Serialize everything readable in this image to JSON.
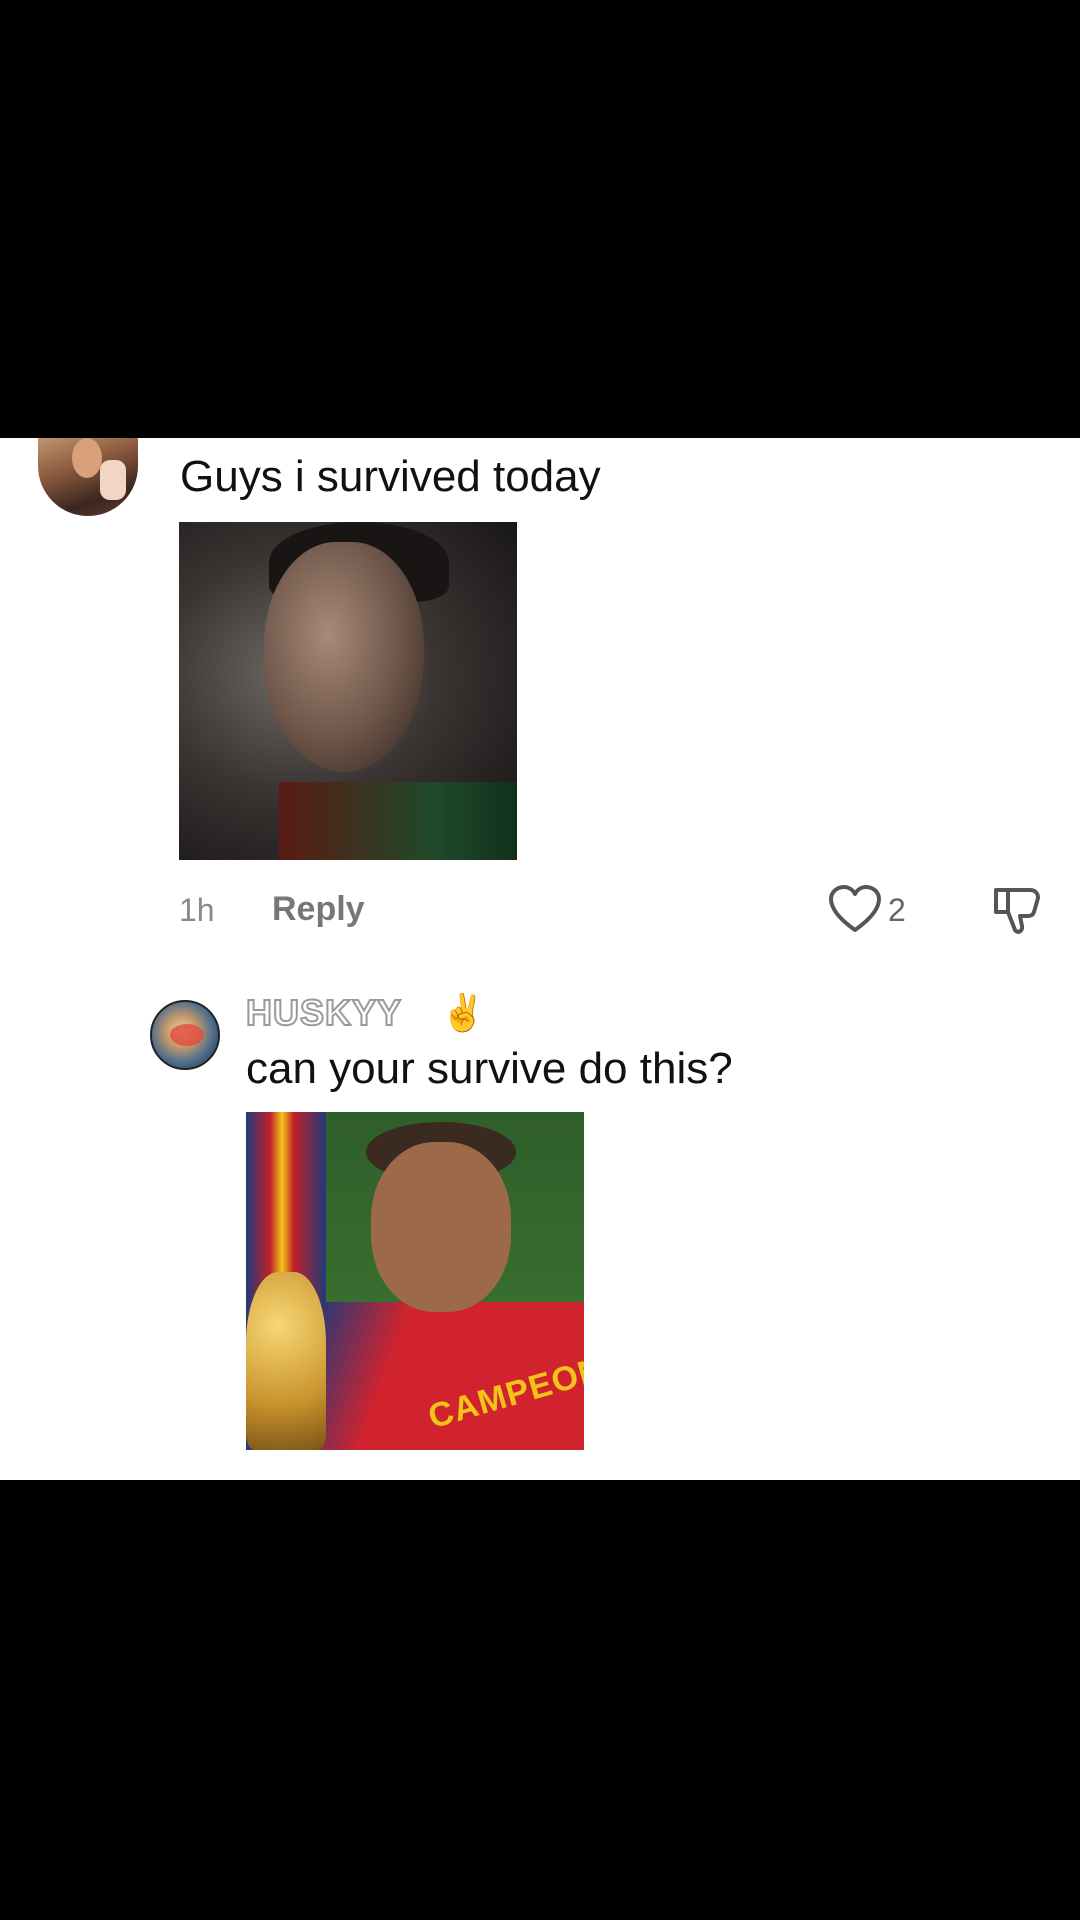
{
  "comments": [
    {
      "text": "Guys i survived today",
      "time": "1h",
      "reply_label": "Reply",
      "like_count": "2"
    },
    {
      "username": "HUSKYY",
      "username_emoji": "😪✌️",
      "text": "can your survive do this?",
      "image_caption_text": "CAMPEON"
    }
  ],
  "icons": {
    "like": "heart-outline-icon",
    "dislike": "thumbs-down-outline-icon"
  },
  "colors": {
    "background": "#000000",
    "panel": "#ffffff",
    "meta_text": "#8a8a8a"
  }
}
